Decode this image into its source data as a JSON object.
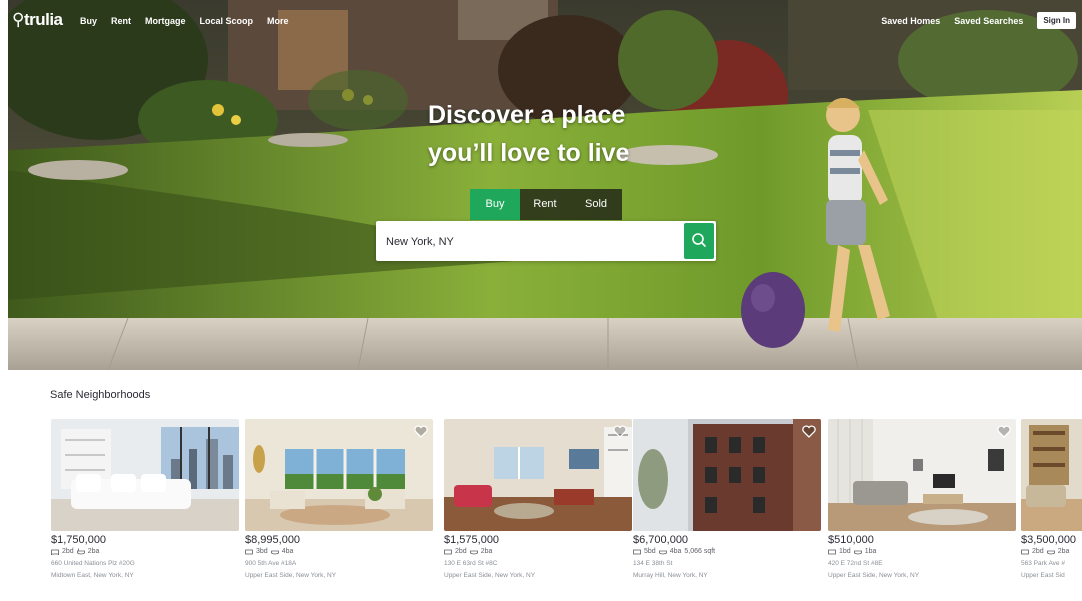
{
  "nav": {
    "logo": "trulia",
    "links": [
      "Buy",
      "Rent",
      "Mortgage",
      "Local Scoop",
      "More"
    ],
    "saved_homes": "Saved Homes",
    "saved_searches": "Saved Searches",
    "sign_in": "Sign In"
  },
  "hero": {
    "headline_line1": "Discover a place",
    "headline_line2": "you’ll love to live",
    "tabs": [
      "Buy",
      "Rent",
      "Sold"
    ],
    "active_tab": "Buy",
    "search_value": "New York, NY",
    "accent_color": "#1fa85b"
  },
  "listings": {
    "section_title": "Safe Neighborhoods",
    "cards": [
      {
        "price": "$1,750,000",
        "beds": "2bd",
        "baths": "2ba",
        "sqft": "",
        "address": "660 United Nations Plz #20G",
        "neighborhood": "Midtown East, New York, NY"
      },
      {
        "price": "$8,995,000",
        "beds": "3bd",
        "baths": "4ba",
        "sqft": "",
        "address": "900 5th Ave #18A",
        "neighborhood": "Upper East Side, New York, NY"
      },
      {
        "price": "$1,575,000",
        "beds": "2bd",
        "baths": "2ba",
        "sqft": "",
        "address": "130 E 63rd St #8C",
        "neighborhood": "Upper East Side, New York, NY"
      },
      {
        "price": "$6,700,000",
        "beds": "5bd",
        "baths": "4ba",
        "sqft": "5,066 sqft",
        "address": "134 E 38th St",
        "neighborhood": "Murray Hill, New York, NY"
      },
      {
        "price": "$510,000",
        "beds": "1bd",
        "baths": "1ba",
        "sqft": "",
        "address": "420 E 72nd St #8E",
        "neighborhood": "Upper East Side, New York, NY"
      },
      {
        "price": "$3,500,000",
        "beds": "2bd",
        "baths": "2ba",
        "sqft": "",
        "address": "563 Park Ave #",
        "neighborhood": "Upper East Sid"
      }
    ]
  }
}
